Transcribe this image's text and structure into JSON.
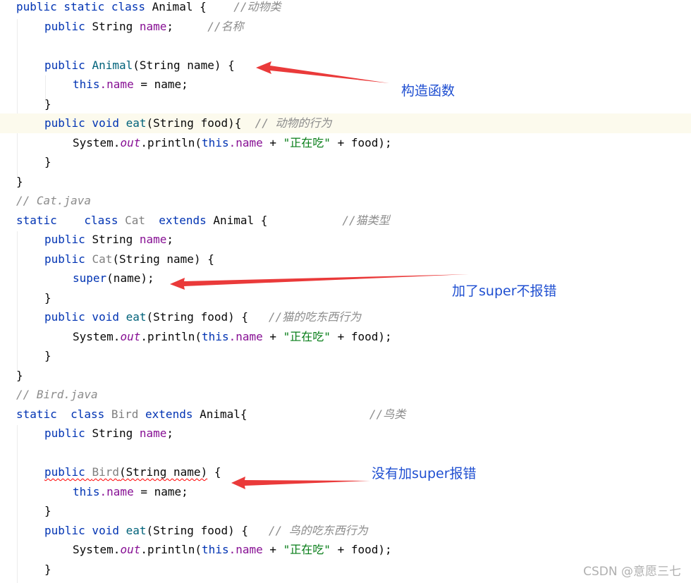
{
  "code": {
    "l01": {
      "t1": "public static class ",
      "t2": "Animal {    ",
      "cm": "//动物类"
    },
    "l02": {
      "kw": "public ",
      "t1": "String ",
      "fld": "name",
      "t2": ";     ",
      "cm": "//名称"
    },
    "l04": {
      "kw": "public ",
      "ctor": "Animal",
      "t1": "(String name) {"
    },
    "l05": {
      "kw": "this",
      "fld": ".name",
      "t1": " = name;"
    },
    "l06": {
      "t1": "}"
    },
    "l07": {
      "kw": "public void ",
      "ctor": "eat",
      "t1": "(String food){  ",
      "cm": "// 动物的行为"
    },
    "l08": {
      "t1": "System.",
      "st": "out",
      "t2": ".println(",
      "kw": "this",
      "fld": ".name",
      "t3": " + ",
      "str": "\"正在吃\"",
      "t4": " + food);"
    },
    "l09": {
      "t1": "}"
    },
    "l10": {
      "t1": "}"
    },
    "l11": {
      "cm": "// Cat.java"
    },
    "l12": {
      "kw1": "static    class ",
      "gray": "Cat  ",
      "kw2": "extends ",
      "t1": "Animal {           ",
      "cm": "//猫类型"
    },
    "l13": {
      "kw": "public ",
      "t1": "String ",
      "fld": "name",
      "t2": ";"
    },
    "l14": {
      "kw": "public ",
      "gray": "Cat",
      "t1": "(String name) {"
    },
    "l15": {
      "kw": "super",
      "t1": "(name);"
    },
    "l16": {
      "t1": "}"
    },
    "l17": {
      "kw": "public void ",
      "ctor": "eat",
      "t1": "(String food) {   ",
      "cm": "//猫的吃东西行为"
    },
    "l18": {
      "t1": "System.",
      "st": "out",
      "t2": ".println(",
      "kw": "this",
      "fld": ".name",
      "t3": " + ",
      "str": "\"正在吃\"",
      "t4": " + food);"
    },
    "l19": {
      "t1": "}"
    },
    "l20": {
      "t1": "}"
    },
    "l21": {
      "cm": "// Bird.java"
    },
    "l22": {
      "kw1": "static  class ",
      "gray": "Bird ",
      "kw2": "extends ",
      "t1": "Animal{                  ",
      "cm": "//鸟类"
    },
    "l23": {
      "kw": "public ",
      "t1": "String ",
      "fld": "name",
      "t2": ";"
    },
    "l25": {
      "kw": "public ",
      "gray": "Bird",
      "t1": "(String name)",
      "t2": " {"
    },
    "l26": {
      "kw": "this",
      "fld": ".name",
      "t1": " = name;"
    },
    "l27": {
      "t1": "}"
    },
    "l28": {
      "kw": "public void ",
      "ctor": "eat",
      "t1": "(String food) {   ",
      "cm": "// 鸟的吃东西行为"
    },
    "l29": {
      "t1": "System.",
      "st": "out",
      "t2": ".println(",
      "kw": "this",
      "fld": ".name",
      "t3": " + ",
      "str": "\"正在吃\"",
      "t4": " + food);"
    },
    "l30": {
      "t1": "}"
    }
  },
  "annotations": {
    "constructor": "构造函数",
    "super_ok": "加了super不报错",
    "no_super_error": "没有加super报错"
  },
  "watermark": "CSDN @意愿三七",
  "colors": {
    "keyword": "#0033b3",
    "field": "#871094",
    "string": "#067d17",
    "comment": "#8c8c8c",
    "annotation": "#1f4fd1",
    "arrow": "#ea3a3a",
    "current_line": "#fcfaed"
  }
}
